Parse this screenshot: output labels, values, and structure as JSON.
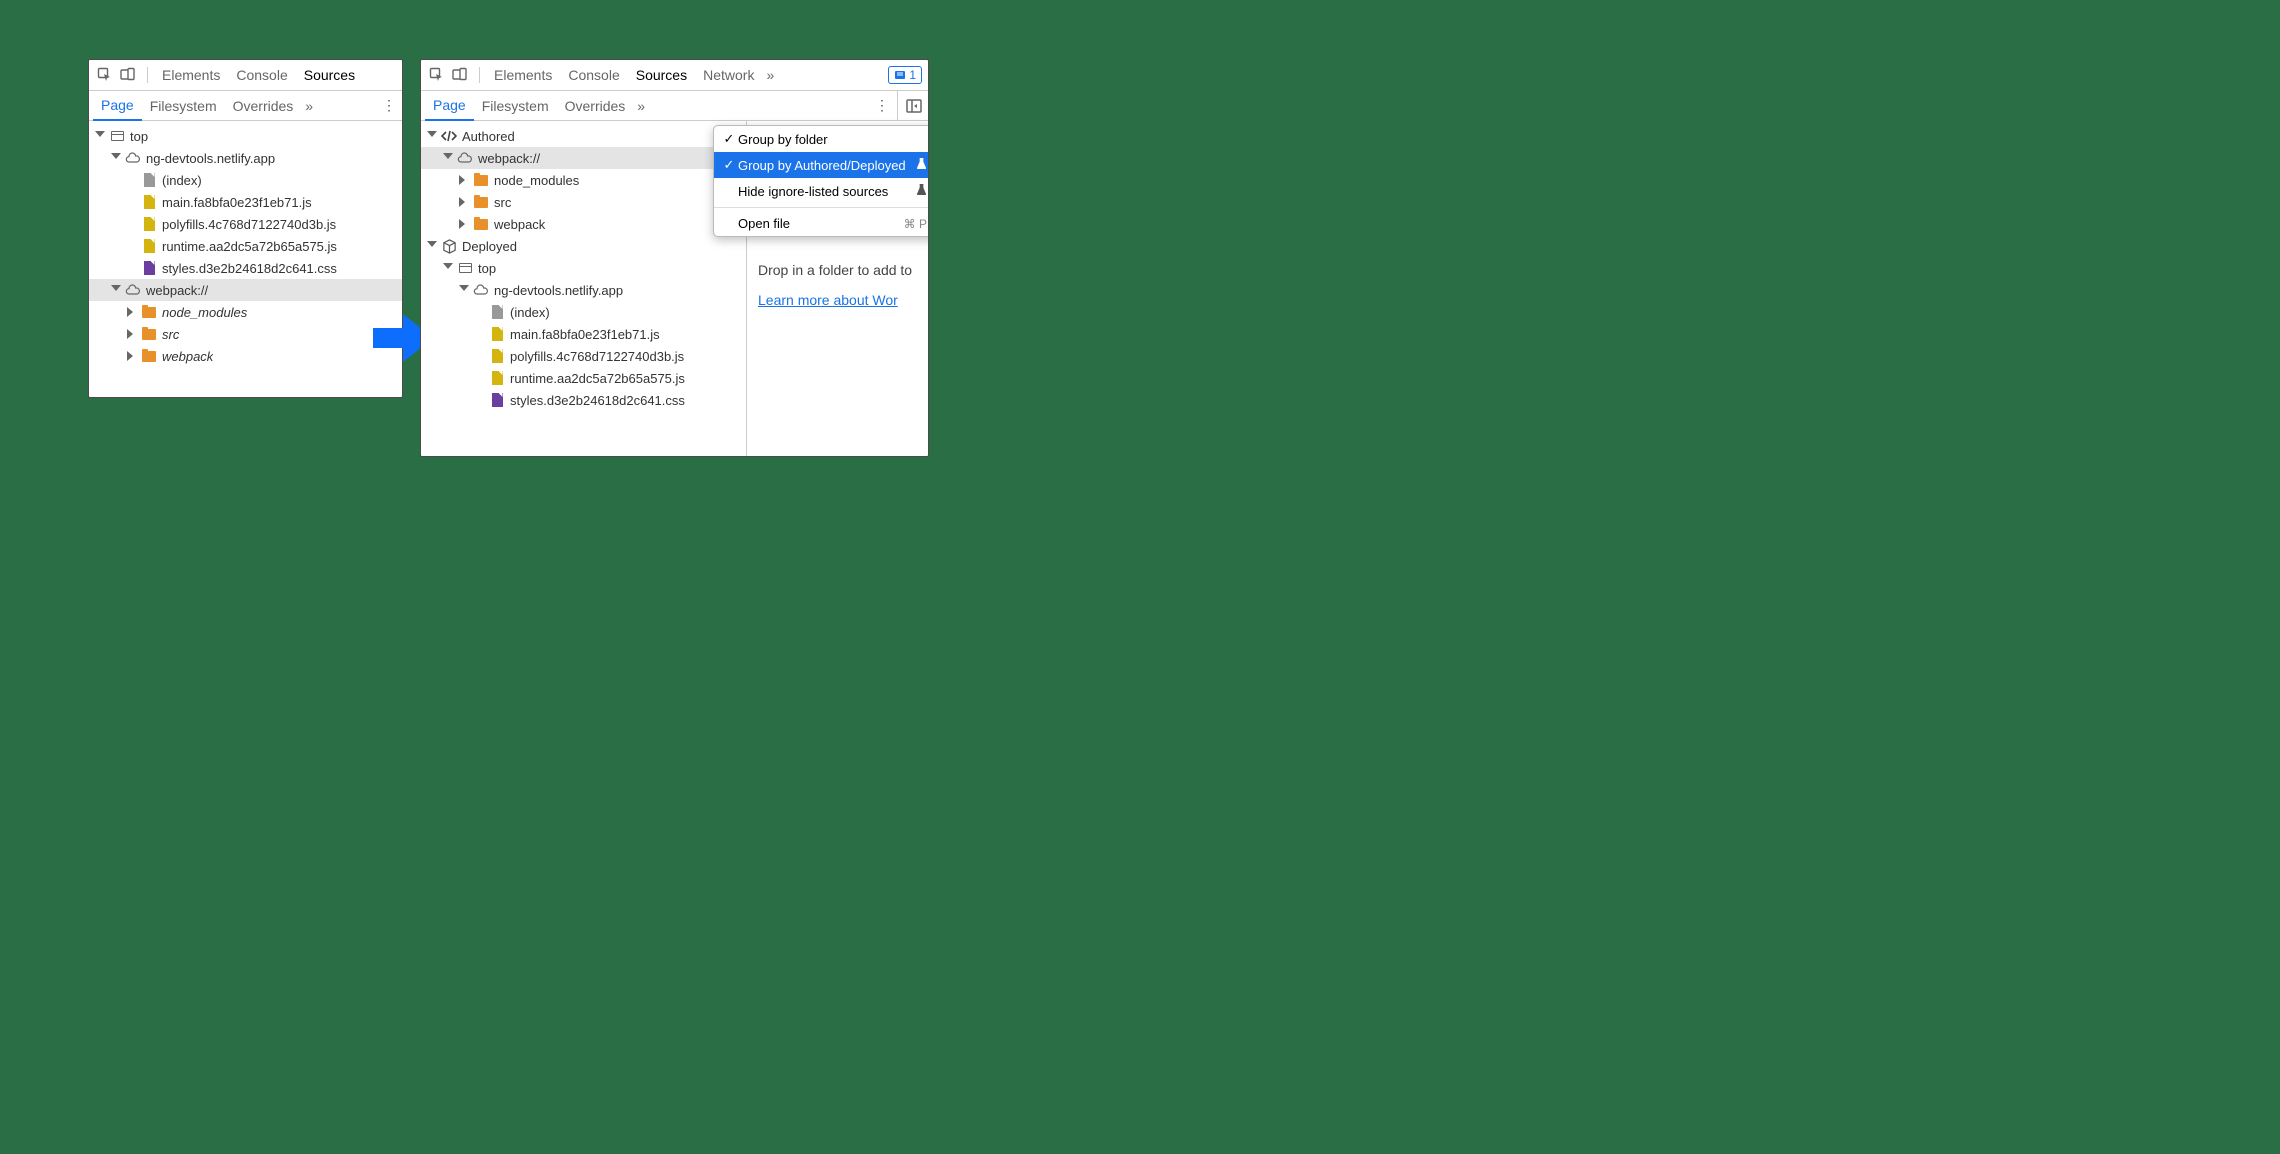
{
  "mainTabs": {
    "elements": "Elements",
    "console": "Console",
    "sources": "Sources",
    "network": "Network"
  },
  "subTabs": {
    "page": "Page",
    "filesystem": "Filesystem",
    "overrides": "Overrides"
  },
  "issues": {
    "count": "1"
  },
  "treeLeft": {
    "top": "top",
    "domain": "ng-devtools.netlify.app",
    "files": {
      "index": "(index)",
      "main": "main.fa8bfa0e23f1eb71.js",
      "polyfills": "polyfills.4c768d7122740d3b.js",
      "runtime": "runtime.aa2dc5a72b65a575.js",
      "styles": "styles.d3e2b24618d2c641.css"
    },
    "webpack": "webpack://",
    "folders": {
      "node_modules": "node_modules",
      "src": "src",
      "webpack": "webpack"
    }
  },
  "treeRight": {
    "authored": "Authored",
    "webpack": "webpack://",
    "folders": {
      "node_modules": "node_modules",
      "src": "src",
      "webpack": "webpack"
    },
    "deployed": "Deployed",
    "top": "top",
    "domain": "ng-devtools.netlify.app",
    "files": {
      "index": "(index)",
      "main": "main.fa8bfa0e23f1eb71.js",
      "polyfills": "polyfills.4c768d7122740d3b.js",
      "runtime": "runtime.aa2dc5a72b65a575.js",
      "styles": "styles.d3e2b24618d2c641.css"
    }
  },
  "menu": {
    "groupByFolder": "Group by folder",
    "groupByAuthored": "Group by Authored/Deployed",
    "hideIgnored": "Hide ignore-listed sources",
    "openFile": "Open file",
    "openFileShortcut": "⌘ P"
  },
  "rightPane": {
    "drop": "Drop in a folder to add to",
    "learn": "Learn more about Wor"
  }
}
